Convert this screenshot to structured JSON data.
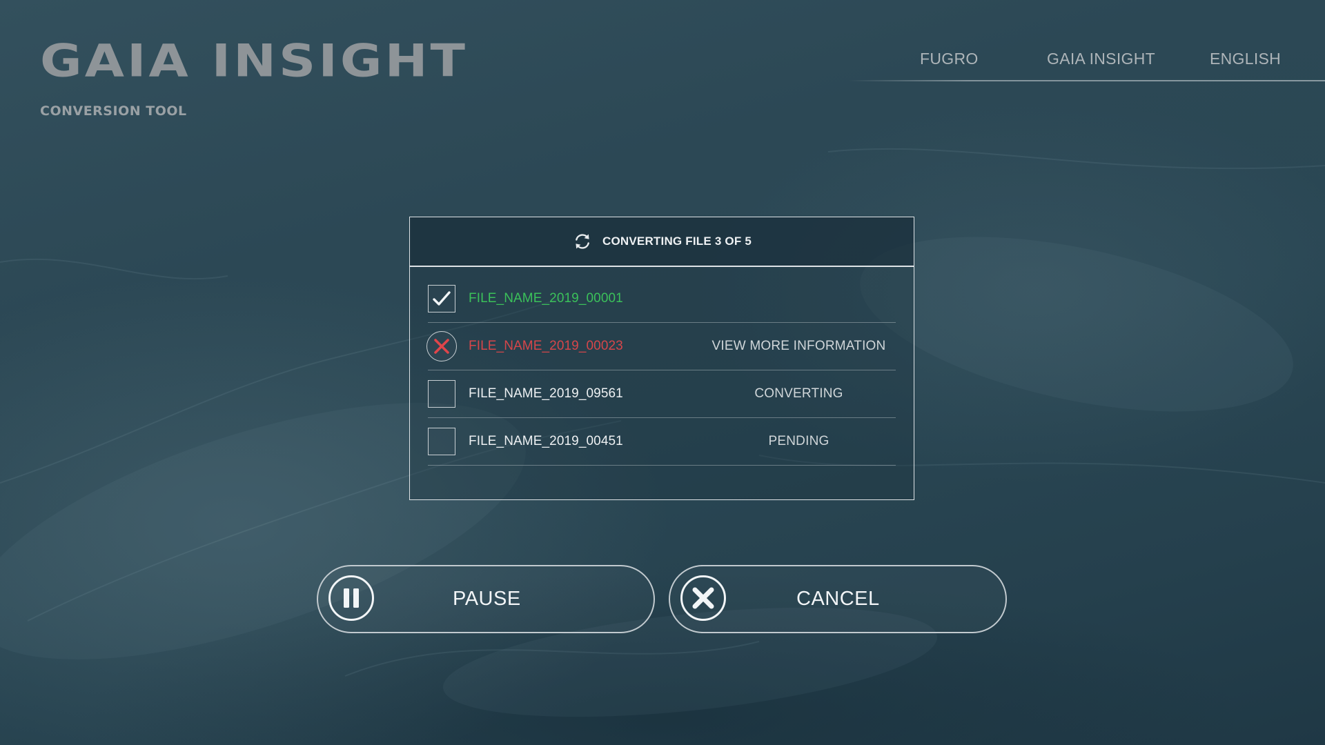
{
  "brand": {
    "logo_text": "GAIA INSIGHT",
    "subtitle": "CONVERSION TOOL"
  },
  "nav": {
    "items": [
      {
        "label": "FUGRO"
      },
      {
        "label": "GAIA INSIGHT"
      },
      {
        "label": "ENGLISH"
      }
    ]
  },
  "dialog": {
    "title": "CONVERTING FILE 3 OF 5",
    "title_icon": "sync-icon",
    "files": [
      {
        "name": "FILE_NAME_2019_00001",
        "state": "done",
        "status_text": "",
        "icon": "checkmark-icon"
      },
      {
        "name": "FILE_NAME_2019_00023",
        "state": "error",
        "status_text": "VIEW MORE INFORMATION",
        "icon": "error-x-icon"
      },
      {
        "name": "FILE_NAME_2019_09561",
        "state": "converting",
        "status_text": "CONVERTING",
        "icon": ""
      },
      {
        "name": "FILE_NAME_2019_00451",
        "state": "pending",
        "status_text": "PENDING",
        "icon": ""
      }
    ]
  },
  "buttons": {
    "pause": {
      "label": "PAUSE",
      "icon": "pause-icon"
    },
    "cancel": {
      "label": "CANCEL",
      "icon": "cancel-x-icon"
    }
  },
  "colors": {
    "success": "#3bc15a",
    "error": "#d6464a",
    "background": "#2c4855"
  }
}
